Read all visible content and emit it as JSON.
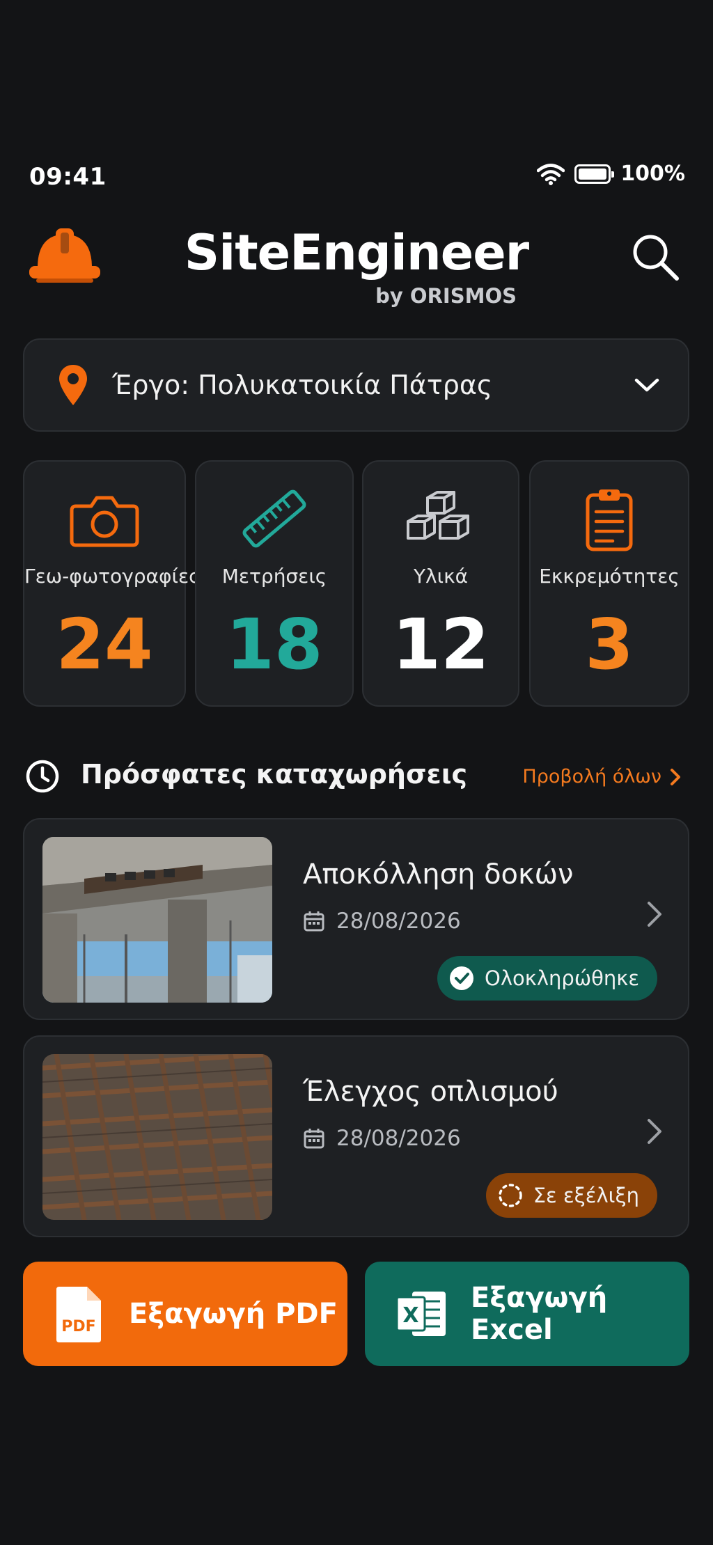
{
  "status_bar": {
    "time": "09:41",
    "battery": "100%"
  },
  "header": {
    "title": "SiteEngineer",
    "subtitle": "by ORISMOS"
  },
  "project": {
    "label": "Έργο: Πολυκατοικία Πάτρας"
  },
  "stats": [
    {
      "label": "Γεω-φωτογραφίες",
      "value": "24",
      "color": "#f5841f",
      "icon": "camera-icon"
    },
    {
      "label": "Μετρήσεις",
      "value": "18",
      "color": "#22a99a",
      "icon": "ruler-icon"
    },
    {
      "label": "Υλικά",
      "value": "12",
      "color": "#ffffff",
      "icon": "boxes-icon"
    },
    {
      "label": "Εκκρεμότητες",
      "value": "3",
      "color": "#f5841f",
      "icon": "clipboard-icon"
    }
  ],
  "recent": {
    "title": "Πρόσφατες καταχωρήσεις",
    "view_all": "Προβολή όλων",
    "items": [
      {
        "title": "Αποκόλληση δοκών",
        "date": "28/08/2026",
        "status": "Ολοκληρώθηκε",
        "status_color": "#0f5a4e"
      },
      {
        "title": "Έλεγχος οπλισμού",
        "date": "28/08/2026",
        "status": "Σε εξέλιξη",
        "status_color": "#8a4208"
      }
    ]
  },
  "actions": {
    "pdf_label": "Εξαγωγή PDF",
    "pdf_icon_text": "PDF",
    "excel_label": "Εξαγωγή Excel",
    "excel_icon_text": "X",
    "pdf_color": "#f26a0c",
    "excel_color": "#0f6b5c"
  }
}
